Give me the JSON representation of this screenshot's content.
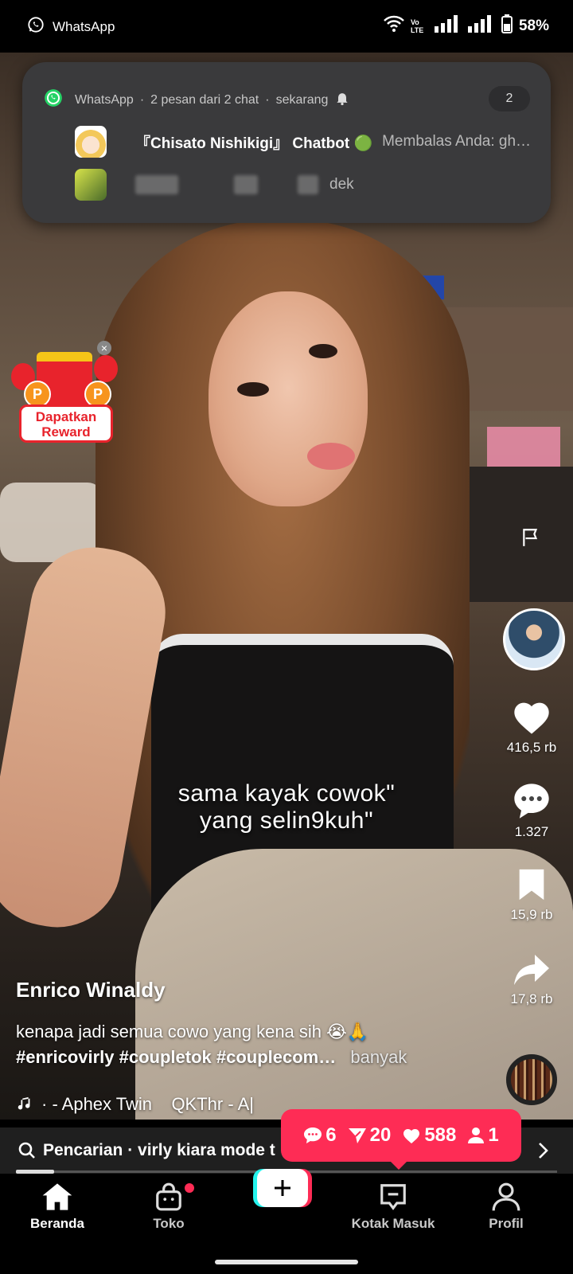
{
  "status_bar": {
    "app_name": "WhatsApp",
    "network": "Vo LTE",
    "battery": "58%"
  },
  "notification": {
    "app": "WhatsApp",
    "summary": "2 pesan dari 2 chat",
    "time": "sekarang",
    "count": "2",
    "messages": [
      {
        "title": "『Chisato Nishikigi』 Chatbot 🟢",
        "text": "Membalas Anda: gh…"
      },
      {
        "title": "",
        "text": "dek"
      }
    ]
  },
  "reward": {
    "line1": "Dapatkan",
    "line2": "Reward"
  },
  "video": {
    "caption_line1": "sama kayak cowok\"",
    "caption_line2": "yang selin9kuh\"",
    "author": "Enrico Winaldy",
    "description": "kenapa jadi semua cowo yang kena sih 😭🙏",
    "hashtags": "#enricovirly #coupletok #couplecom…",
    "more": "banyak",
    "music": "· - Aphex Twin    QKThr - A|"
  },
  "actions": {
    "likes": "416,5 rb",
    "comments": "1.327",
    "saves": "15,9 rb",
    "shares": "17,8 rb"
  },
  "inbox_popup": {
    "comments": "6",
    "mentions": "20",
    "likes": "588",
    "followers": "1"
  },
  "search": {
    "text": "Pencarian · virly kiara mode t"
  },
  "progress": 0.07,
  "nav": {
    "home": "Beranda",
    "shop": "Toko",
    "inbox": "Kotak Masuk",
    "profile": "Profil"
  },
  "colors": {
    "accent": "#fe2c55",
    "whatsapp": "#25d366",
    "cyan": "#25f4ee"
  }
}
